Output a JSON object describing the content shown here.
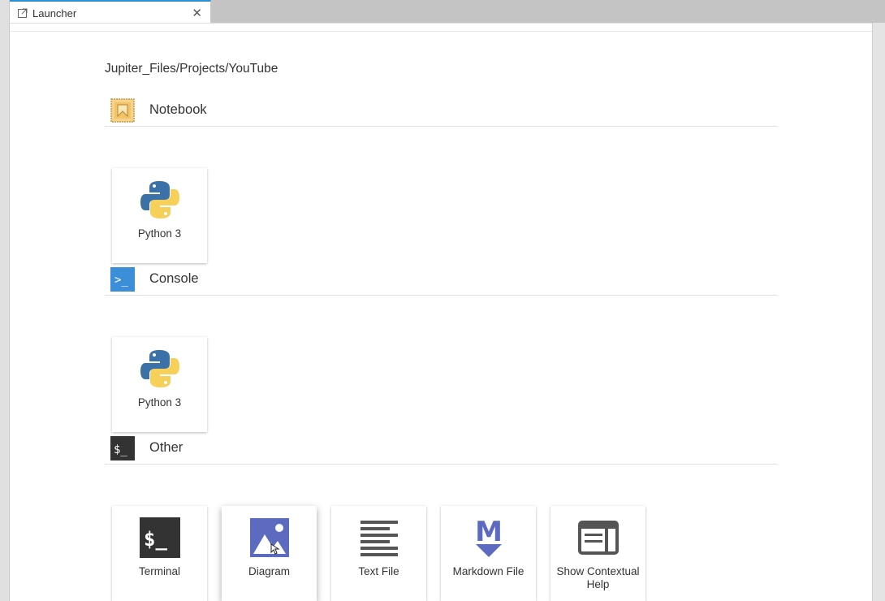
{
  "tab": {
    "label": "Launcher",
    "close_symbol": "✕",
    "icon": "launcher-tab-icon"
  },
  "launcher": {
    "cwd": "Jupiter_Files/Projects/YouTube",
    "sections": {
      "notebook": {
        "title": "Notebook",
        "icon": "notebook-icon",
        "items": [
          {
            "label": "Python 3",
            "icon": "python-icon"
          }
        ]
      },
      "console": {
        "title": "Console",
        "icon": "console-icon",
        "icon_text": ">_",
        "items": [
          {
            "label": "Python 3",
            "icon": "python-icon"
          }
        ]
      },
      "other": {
        "title": "Other",
        "icon": "terminal-icon",
        "icon_text": "$_",
        "items": [
          {
            "label": "Terminal",
            "icon": "terminal-icon",
            "icon_text": "$_"
          },
          {
            "label": "Diagram",
            "icon": "diagram-icon"
          },
          {
            "label": "Text File",
            "icon": "text-file-icon"
          },
          {
            "label": "Markdown File",
            "icon": "markdown-icon",
            "icon_text": "M"
          },
          {
            "label": "Show Contextual Help",
            "icon": "contextual-help-icon"
          }
        ]
      }
    }
  },
  "colors": {
    "accent": "#2a8fd6",
    "notebook_orange": "#f0a830",
    "console_blue": "#3a8fd8",
    "terminal_dark": "#333333",
    "diagram_purple": "#5c6bc0",
    "markdown_purple": "#5c6bc0",
    "python_blue": "#3a72a8",
    "python_yellow": "#f7d05a"
  }
}
